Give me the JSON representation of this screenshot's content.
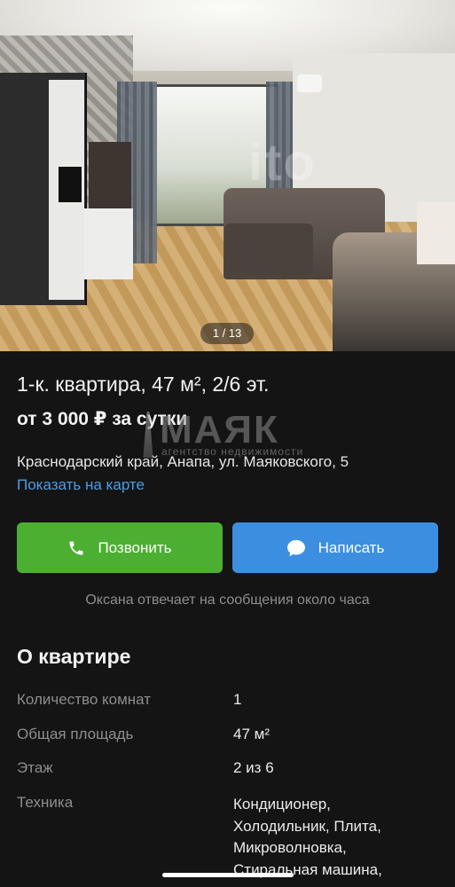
{
  "gallery": {
    "counter": "1 / 13",
    "watermark": "ito"
  },
  "listing": {
    "title": "1-к. квартира, 47 м², 2/6 эт.",
    "price": "от 3 000 ₽ за сутки",
    "address": "Краснодарский край, Анапа, ул. Маяковского, 5",
    "map_link": "Показать на карте"
  },
  "logo_watermark": {
    "name": "МАЯК",
    "tagline": "агентство недвижимости"
  },
  "actions": {
    "call_label": "Позвонить",
    "message_label": "Написать",
    "call_color": "#4caf32",
    "message_color": "#3c8fe0"
  },
  "seller": {
    "response_note": "Оксана отвечает на сообщения около часа"
  },
  "about": {
    "title": "О квартире",
    "params": [
      {
        "label": "Количество комнат",
        "value": "1"
      },
      {
        "label": "Общая площадь",
        "value": "47 м²"
      },
      {
        "label": "Этаж",
        "value": "2 из 6"
      },
      {
        "label": "Техника",
        "value": [
          "Кондиционер,",
          "Холодильник, Плита,",
          "Микроволновка,",
          "Стиральная машина,"
        ]
      }
    ]
  },
  "icons": {
    "call": "phone-icon",
    "message": "chat-bubble-icon"
  }
}
